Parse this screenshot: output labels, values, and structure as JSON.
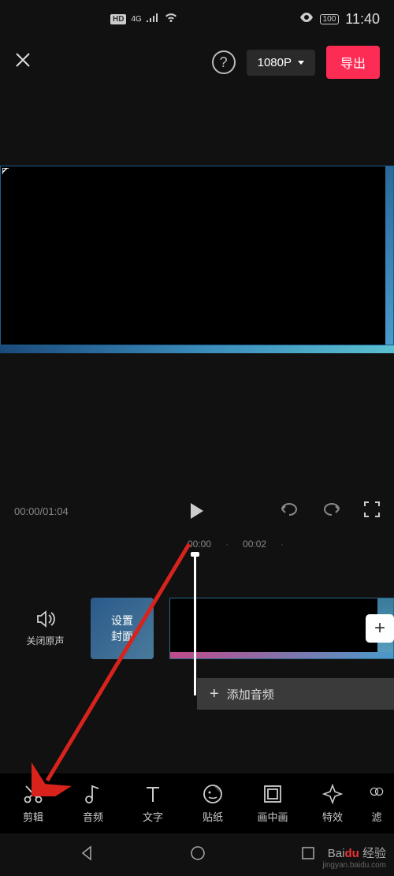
{
  "status": {
    "hd": "HD",
    "network": "4G",
    "battery": "100",
    "time": "11:40"
  },
  "topbar": {
    "help": "?",
    "resolution": "1080P",
    "export": "导出"
  },
  "playback": {
    "current": "00:00",
    "total": "01:04",
    "separator": "/"
  },
  "timeline": {
    "marks": [
      "00:00",
      "00:02"
    ],
    "dot": "·"
  },
  "mute": {
    "label": "关闭原声"
  },
  "cover": {
    "line1": "设置",
    "line2": "封面"
  },
  "audio": {
    "add_icon": "+",
    "add_label": "添加音频"
  },
  "tools": [
    {
      "id": "edit",
      "label": "剪辑"
    },
    {
      "id": "audio",
      "label": "音频"
    },
    {
      "id": "text",
      "label": "文字"
    },
    {
      "id": "sticker",
      "label": "贴纸"
    },
    {
      "id": "pip",
      "label": "画中画"
    },
    {
      "id": "effect",
      "label": "特效"
    },
    {
      "id": "more",
      "label": "滤"
    }
  ],
  "watermark": {
    "brand_prefix": "Bai",
    "brand_mid": "du",
    "brand_suffix": "经验",
    "url": "jingyan.baidu.com"
  }
}
